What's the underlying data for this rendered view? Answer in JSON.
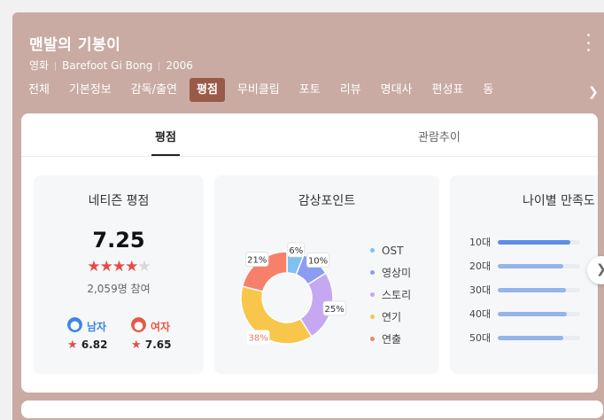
{
  "header": {
    "title": "맨발의 기봉이",
    "meta": [
      "영화",
      "Barefoot Gi Bong",
      "2006"
    ],
    "more_icon": "more-vertical-icon"
  },
  "tabs": [
    "전체",
    "기본정보",
    "감독/출연",
    "평점",
    "무비클립",
    "포토",
    "리뷰",
    "명대사",
    "편성표",
    "동"
  ],
  "active_tab": "평점",
  "subtabs": [
    "평점",
    "관람추이"
  ],
  "active_subtab": "평점",
  "netizen": {
    "title": "네티즌 평점",
    "score": "7.25",
    "stars": "4 of 5",
    "count": "2,059명 참여",
    "male": {
      "label": "남자",
      "score": "6.82",
      "color": "#3b86e6"
    },
    "female": {
      "label": "여자",
      "score": "7.65",
      "color": "#e55a46"
    }
  },
  "appeal": {
    "title": "감상포인트",
    "chart_data": {
      "type": "pie",
      "categories": [
        "OST",
        "영상미",
        "스토리",
        "연기",
        "연출"
      ],
      "values": [
        6,
        10,
        25,
        38,
        21
      ],
      "labels": [
        "6%",
        "10%",
        "25%",
        "38%",
        "21%"
      ],
      "colors": [
        "#7fc1f0",
        "#8b9cf2",
        "#c6a8f2",
        "#f9c64c",
        "#f7806a"
      ]
    }
  },
  "age": {
    "title": "나이별 만족도",
    "chart_data": {
      "type": "bar",
      "categories": [
        "10대",
        "20대",
        "30대",
        "40대",
        "50대"
      ],
      "values": [
        0.88,
        0.8,
        0.83,
        0.84,
        0.8
      ],
      "colors": [
        "#5b8ee8",
        "#93b4ec",
        "#93b4ec",
        "#93b4ec",
        "#93b4ec"
      ]
    }
  }
}
